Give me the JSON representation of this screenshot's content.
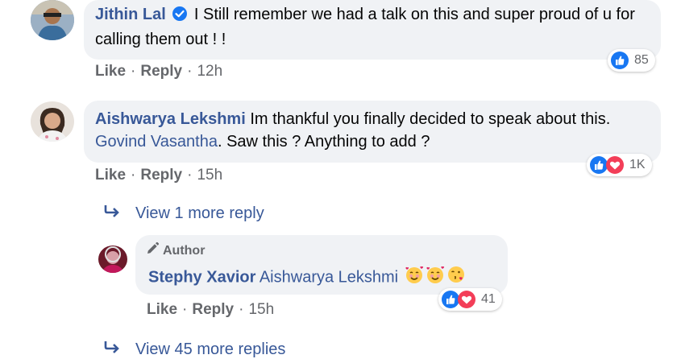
{
  "comments": [
    {
      "author": "Jithin Lal",
      "verified": true,
      "text": "I Still remember we had a talk on this and super proud of u for calling them out ! !",
      "actions": {
        "like": "Like",
        "reply": "Reply",
        "time": "12h"
      },
      "reactions": {
        "count": "85",
        "types": [
          "like"
        ]
      }
    },
    {
      "author": "Aishwarya Lekshmi",
      "text_part1": "Im thankful you finally decided to speak about this.",
      "tagged": "Govind Vasantha",
      "text_part2": ". Saw this ? Anything to add ?",
      "actions": {
        "like": "Like",
        "reply": "Reply",
        "time": "15h"
      },
      "reactions": {
        "count": "1K",
        "types": [
          "like",
          "love"
        ]
      },
      "view_more": "View 1 more reply",
      "reply": {
        "badge": "Author",
        "author": "Stephy Xavior",
        "tagged": "Aishwarya Lekshmi",
        "emojis": [
          "smiling-face-with-hearts",
          "smiling-face-with-hearts",
          "face-blowing-kiss"
        ],
        "actions": {
          "like": "Like",
          "reply": "Reply",
          "time": "15h"
        },
        "reactions": {
          "count": "41",
          "types": [
            "like",
            "love"
          ]
        }
      }
    }
  ],
  "view_more_bottom": "View 45 more replies",
  "colors": {
    "like_blue": "#1877f2",
    "love_red": "#f33e58",
    "name_blue": "#385898",
    "bubble": "#f0f2f5"
  }
}
